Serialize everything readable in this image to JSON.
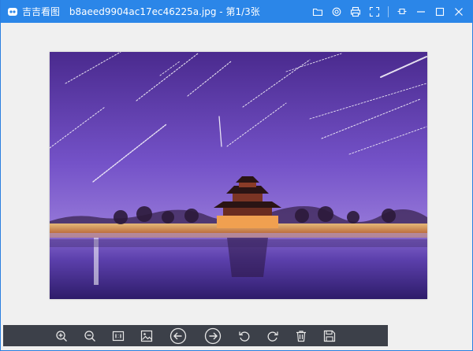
{
  "window": {
    "app_name": "吉吉看图",
    "file_title": "b8aeed9904ac17ec46225a.jpg - 第1/3张"
  },
  "titlebar_icons": [
    "folder-icon",
    "settings-icon",
    "print-icon",
    "fullscreen-icon",
    "pin-icon",
    "minimize-icon",
    "maximize-icon",
    "close-icon"
  ],
  "toolbar_icons": [
    "zoom-in-icon",
    "zoom-out-icon",
    "actual-size-icon",
    "fit-image-icon",
    "previous-icon",
    "next-icon",
    "rotate-left-icon",
    "rotate-right-icon",
    "delete-icon",
    "save-icon"
  ],
  "colors": {
    "titlebar": "#2b86e8",
    "toolbar": "#3c4049",
    "sky_top": "#4a2a8e",
    "sky_bottom": "#a58ce0",
    "water": "#5a3ea8"
  }
}
